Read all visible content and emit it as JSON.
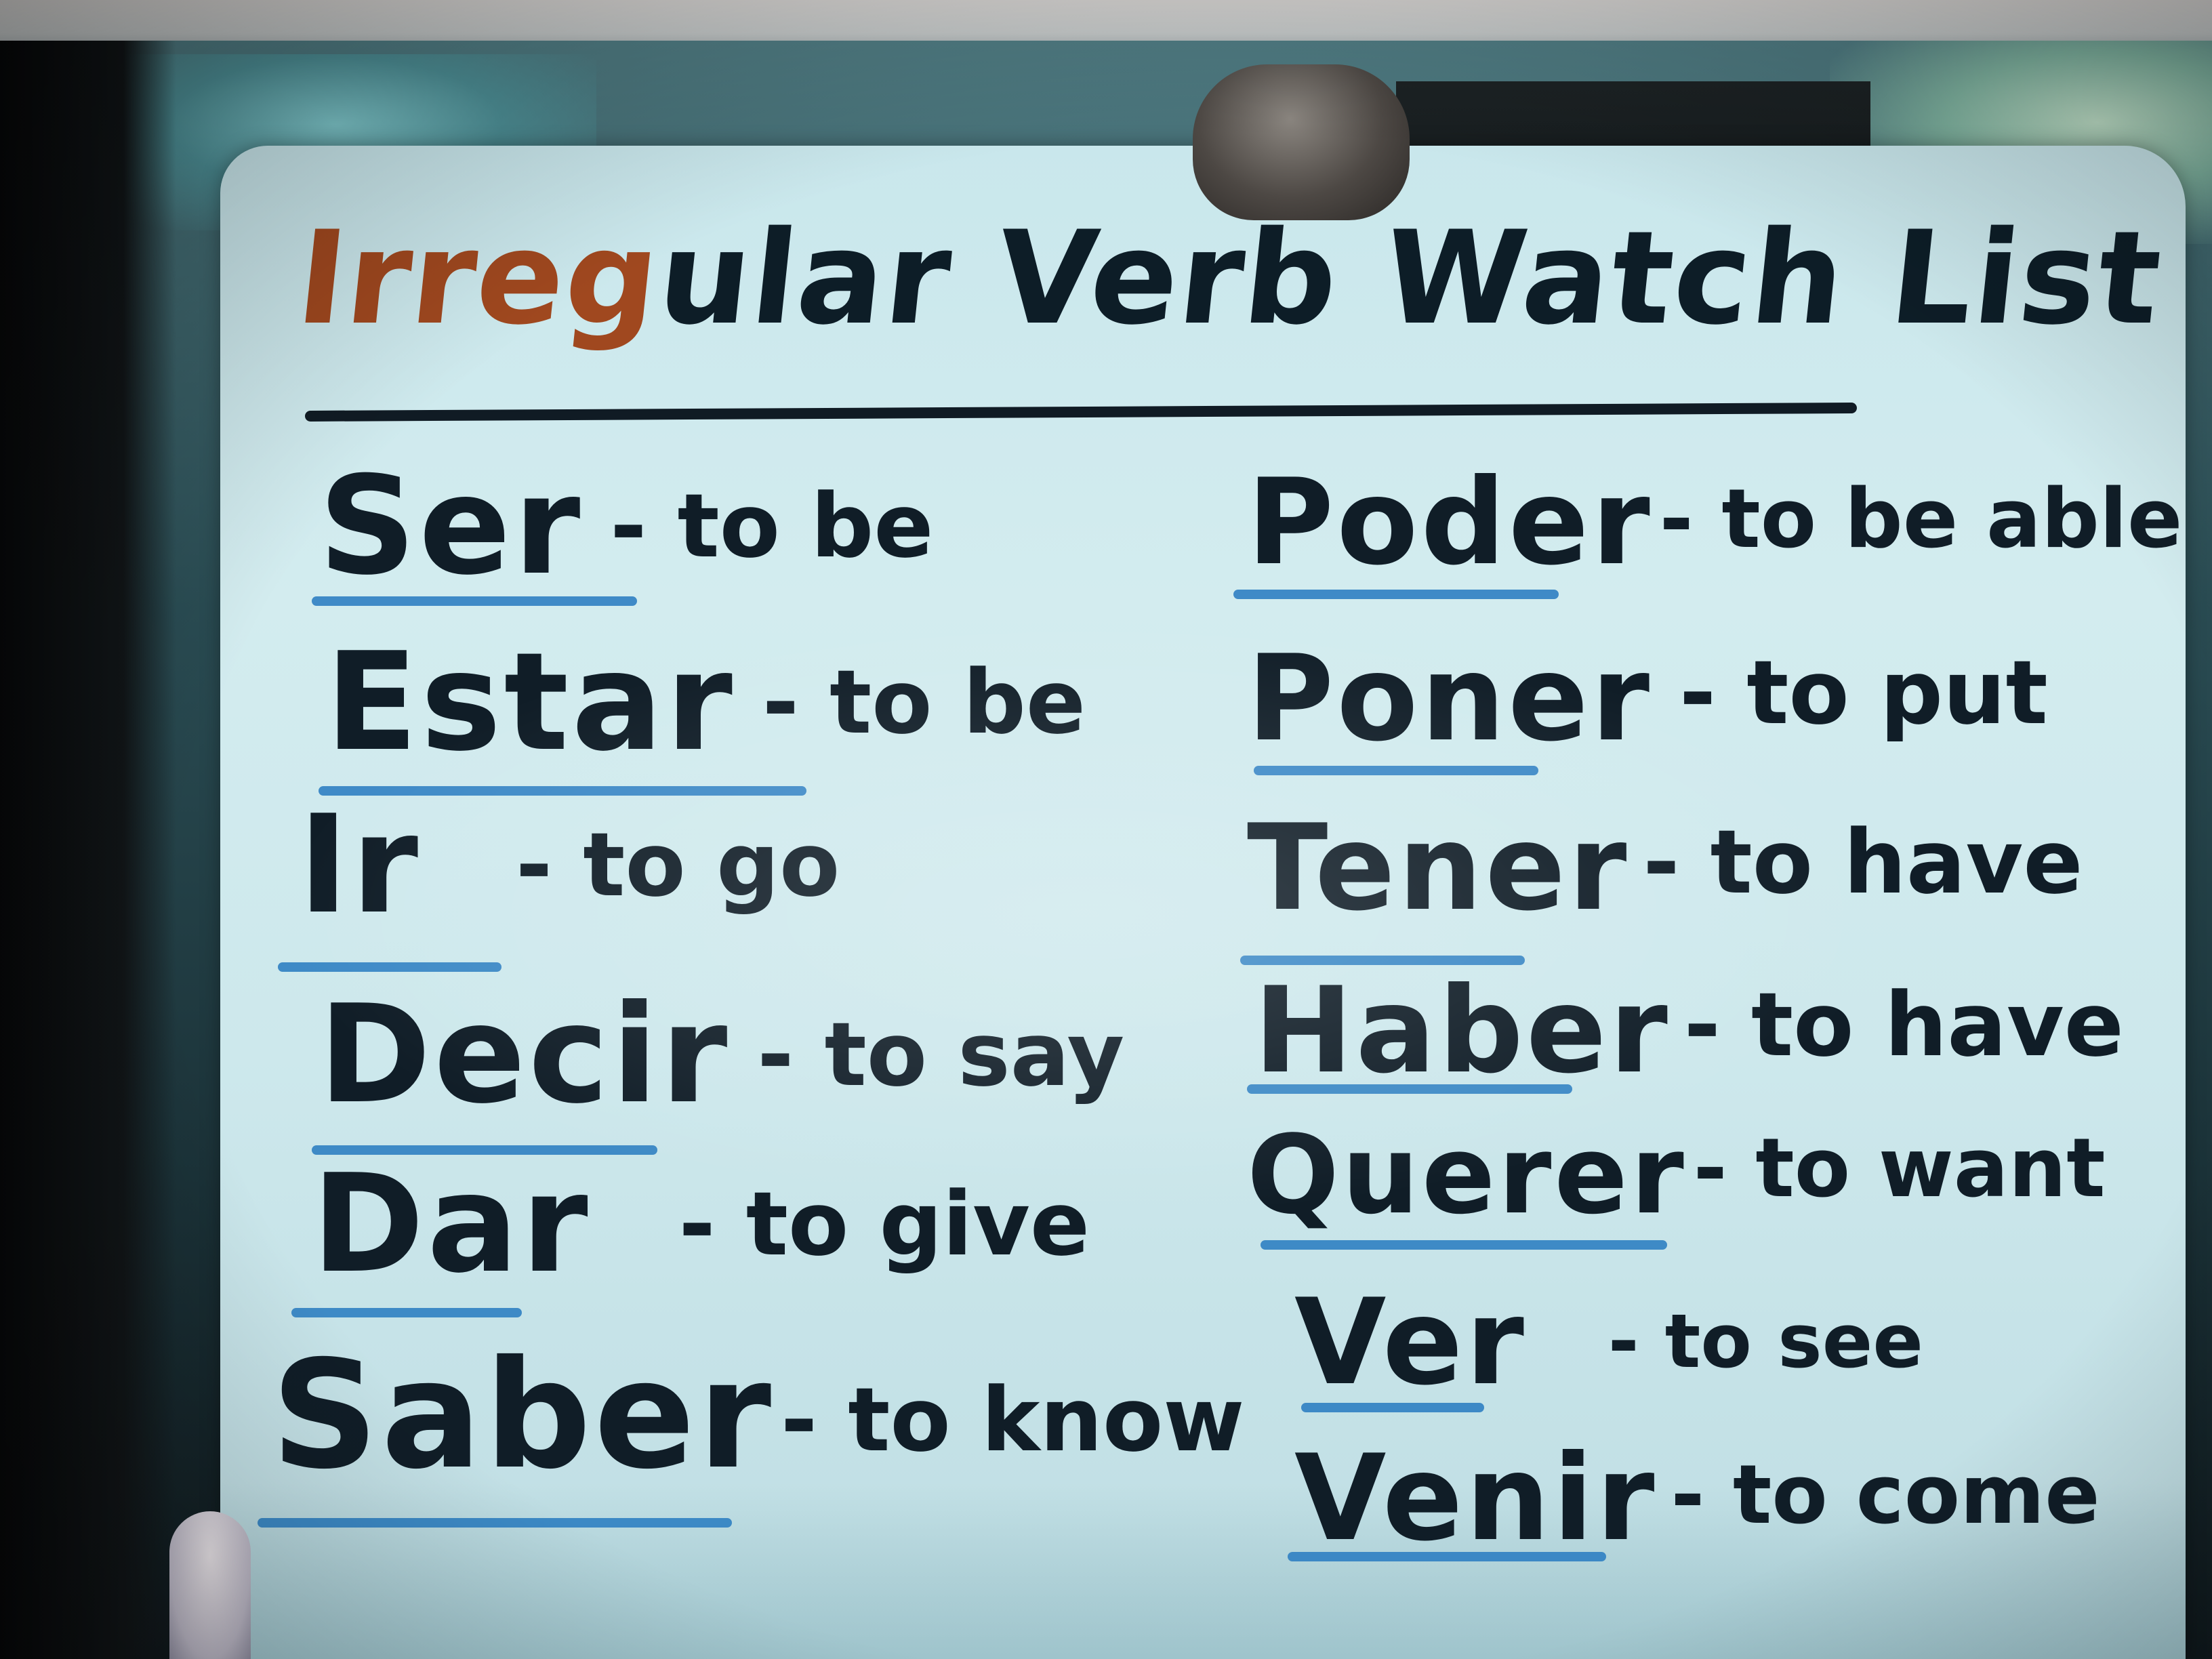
{
  "board": {
    "title": "Irregular Verb Watch List",
    "left_column": [
      {
        "verb": "Ser",
        "meaning": "- to be"
      },
      {
        "verb": "Estar",
        "meaning": "- to be"
      },
      {
        "verb": "Ir",
        "meaning": "- to go"
      },
      {
        "verb": "Decir",
        "meaning": "- to say"
      },
      {
        "verb": "Dar",
        "meaning": "- to give"
      },
      {
        "verb": "Saber",
        "meaning": "- to know"
      }
    ],
    "right_column": [
      {
        "verb": "Poder",
        "meaning": "- to be able"
      },
      {
        "verb": "Poner",
        "meaning": "- to put"
      },
      {
        "verb": "Tener",
        "meaning": "- to have"
      },
      {
        "verb": "Haber",
        "meaning": "- to have"
      },
      {
        "verb": "Querer",
        "meaning": "- to want"
      },
      {
        "verb": "Ver",
        "meaning": "- to see"
      },
      {
        "verb": "Venir",
        "meaning": "- to come"
      }
    ]
  },
  "colors": {
    "board": "#cde8ec",
    "ink": "#101d27",
    "underline_blue": "#2f7fc2",
    "title_highlight": "#a0481f"
  }
}
